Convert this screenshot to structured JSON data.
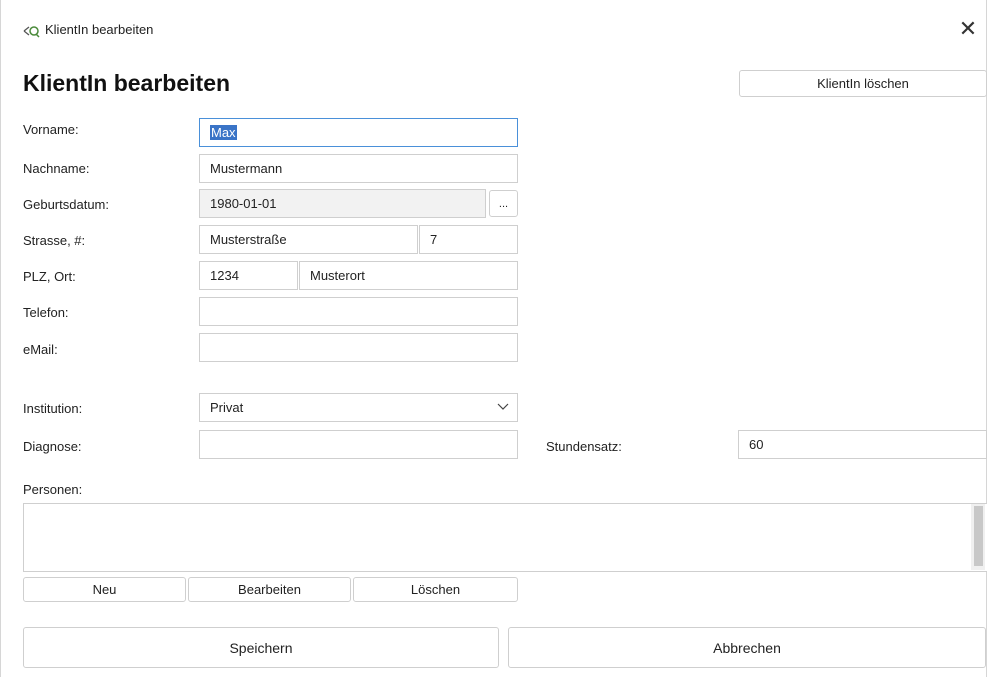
{
  "window": {
    "title": "KlientIn bearbeiten",
    "icon": "app-icon"
  },
  "heading": "KlientIn bearbeiten",
  "delete_client_button": "KlientIn löschen",
  "labels": {
    "vorname": "Vorname:",
    "nachname": "Nachname:",
    "geburtsdatum": "Geburtsdatum:",
    "strasse": "Strasse, #:",
    "plz_ort": "PLZ, Ort:",
    "telefon": "Telefon:",
    "email": "eMail:",
    "institution": "Institution:",
    "diagnose": "Diagnose:",
    "stundensatz": "Stundensatz:",
    "personen": "Personen:"
  },
  "fields": {
    "vorname": "Max",
    "nachname": "Mustermann",
    "geburtsdatum": "1980-01-01",
    "date_picker_button": "...",
    "strasse": "Musterstraße",
    "hausnummer": "7",
    "plz": "1234",
    "ort": "Musterort",
    "telefon": "",
    "email": "",
    "institution": "Privat",
    "diagnose": "",
    "stundensatz": "60"
  },
  "personen_buttons": {
    "neu": "Neu",
    "bearbeiten": "Bearbeiten",
    "loeschen": "Löschen"
  },
  "footer": {
    "speichern": "Speichern",
    "abbrechen": "Abbrechen"
  }
}
